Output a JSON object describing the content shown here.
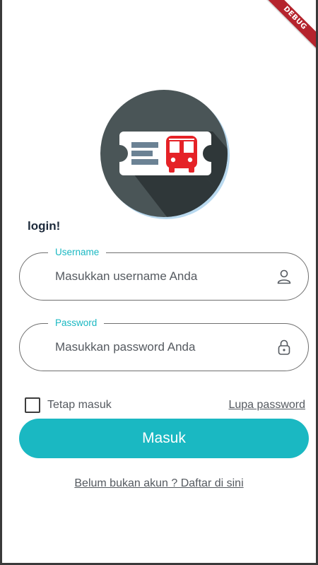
{
  "debug_banner": "DEBUG",
  "login": {
    "title": "login!"
  },
  "username": {
    "label": "Username",
    "placeholder": "Masukkan username Anda",
    "icon": "person-icon"
  },
  "password": {
    "label": "Password",
    "placeholder": "Masukkan password Anda",
    "icon": "lock-icon"
  },
  "remember": {
    "label": "Tetap masuk",
    "checked": false
  },
  "forgot_label": "Lupa password",
  "submit_label": "Masuk",
  "register_label": "Belum bukan akun ? Daftar di sini",
  "colors": {
    "accent": "#1ab8c2",
    "logo_circle": "#4a5557",
    "bus_red": "#e52227",
    "debug_red": "#b5242d"
  }
}
